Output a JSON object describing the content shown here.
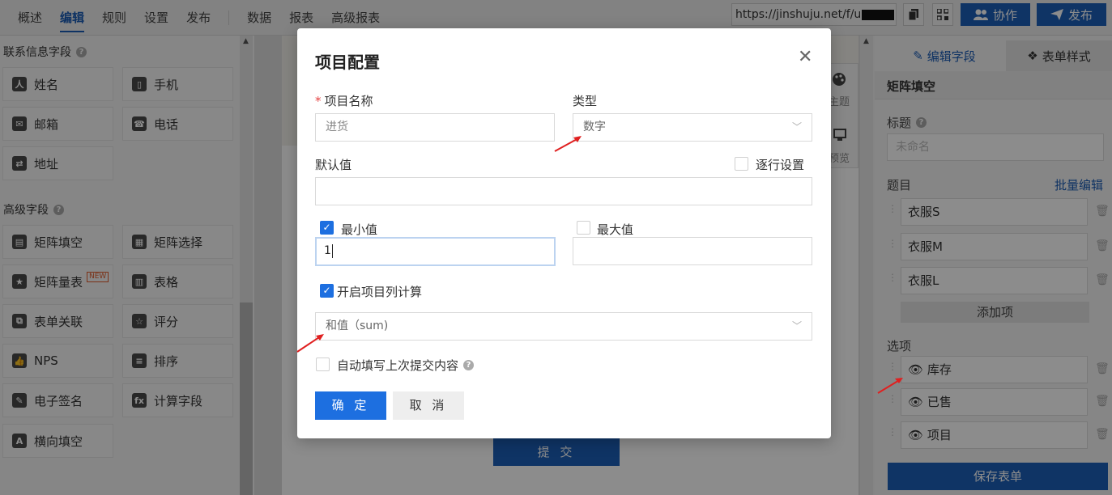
{
  "nav": {
    "items": [
      "概述",
      "编辑",
      "规则",
      "设置",
      "发布"
    ],
    "items2": [
      "数据",
      "报表",
      "高级报表"
    ],
    "url": "https://jinshuju.net/f/u",
    "collab_label": "协作",
    "publish_label": "发布"
  },
  "left": {
    "contact_title": "联系信息字段",
    "contact_fields": [
      "姓名",
      "手机",
      "邮箱",
      "电话",
      "地址"
    ],
    "advanced_title": "高级字段",
    "advanced_fields": [
      "矩阵填空",
      "矩阵选择",
      "矩阵量表",
      "表格",
      "表单关联",
      "评分",
      "NPS",
      "排序",
      "电子签名",
      "计算字段",
      "横向填空"
    ],
    "new_badge": "NEW"
  },
  "canvas": {
    "submit_label": "提 交",
    "tool_theme": "主题",
    "tool_preview": "预览"
  },
  "right": {
    "tab_edit": "编辑字段",
    "tab_style": "表单样式",
    "field_type": "矩阵填空",
    "title_label": "标题",
    "title_placeholder": "未命名",
    "questions_label": "题目",
    "bulk_edit": "批量编辑",
    "questions": [
      "衣服S",
      "衣服M",
      "衣服L"
    ],
    "add_item": "添加项",
    "options_label": "选项",
    "options": [
      "库存",
      "已售",
      "项目"
    ],
    "save_label": "保存表单"
  },
  "modal": {
    "title": "项目配置",
    "name_label": "项目名称",
    "name_placeholder": "进货",
    "type_label": "类型",
    "type_value": "数字",
    "default_label": "默认值",
    "row_setting_label": "逐行设置",
    "min_label": "最小值",
    "min_value": "1",
    "max_label": "最大值",
    "calc_label": "开启项目列计算",
    "calc_value": "和值（sum)",
    "autofill_label": "自动填写上次提交内容",
    "ok_label": "确 定",
    "cancel_label": "取 消"
  },
  "colors": {
    "brand": "#1d5fb8",
    "primary": "#1d6fe0",
    "annotation": "#e02020"
  }
}
